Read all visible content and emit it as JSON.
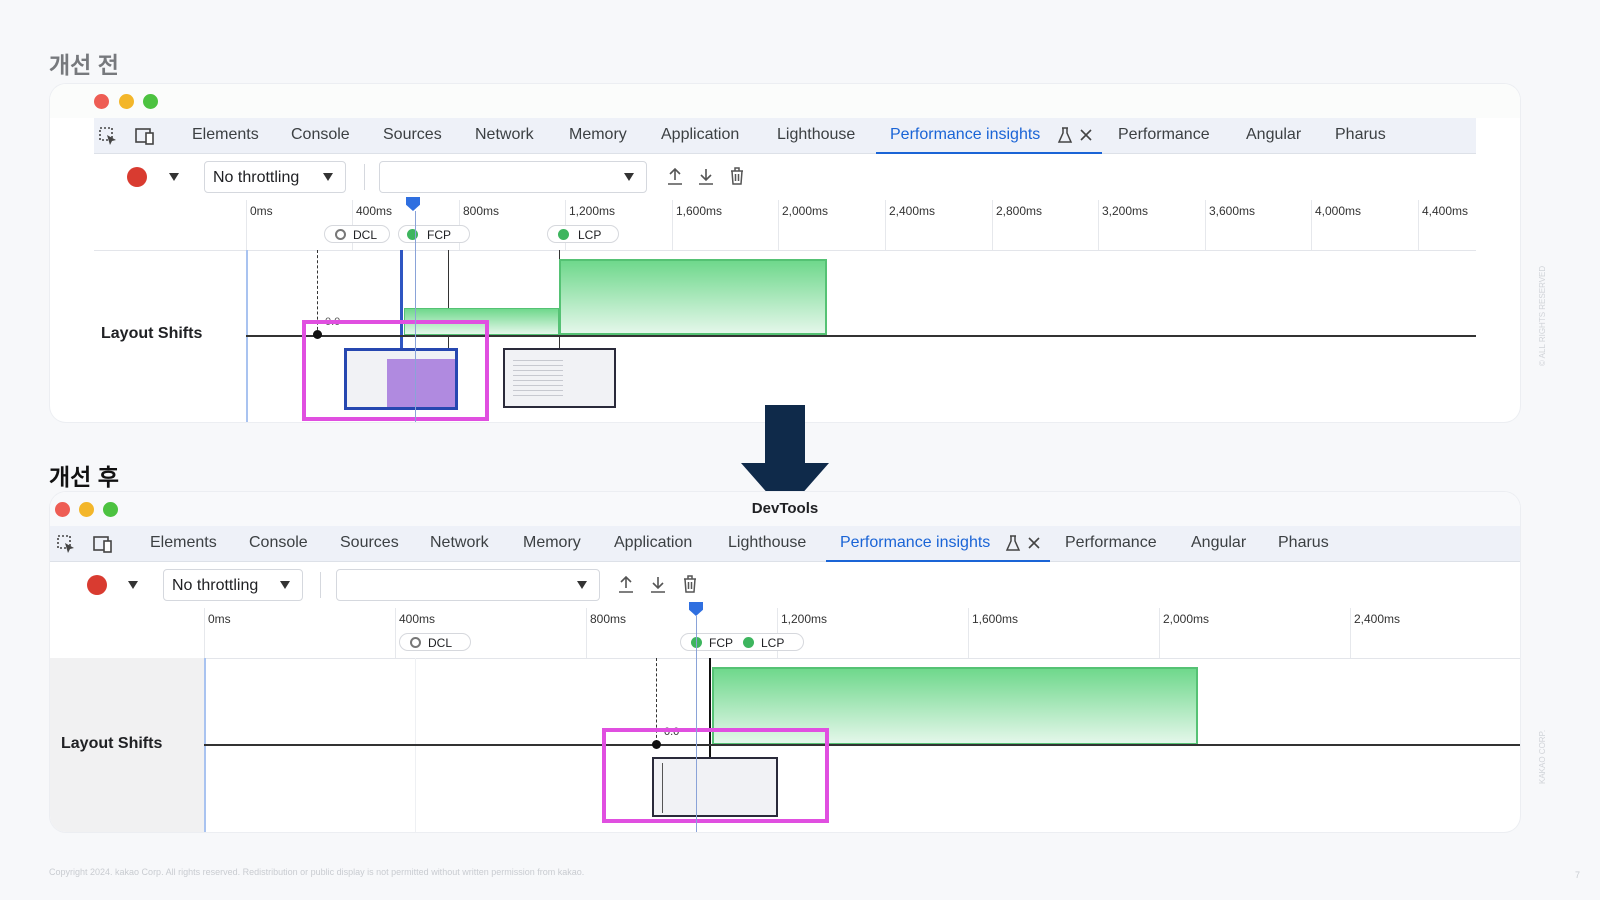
{
  "before": {
    "section_title": "개선 전",
    "tabs": [
      "Elements",
      "Console",
      "Sources",
      "Network",
      "Memory",
      "Application",
      "Lighthouse",
      "Performance insights",
      "Performance",
      "Angular",
      "Pharus"
    ],
    "throttling": "No throttling",
    "ruler_ticks": [
      "0ms",
      "400ms",
      "800ms",
      "1,200ms",
      "1,600ms",
      "2,000ms",
      "2,400ms",
      "2,800ms",
      "3,200ms",
      "3,600ms",
      "4,000ms",
      "4,400ms"
    ],
    "markers": {
      "dcl": "DCL",
      "fcp": "FCP",
      "lcp": "LCP"
    },
    "track_label": "Layout Shifts",
    "shift_value": "0.0"
  },
  "after": {
    "section_title": "개선 후",
    "window_title": "DevTools",
    "tabs": [
      "Elements",
      "Console",
      "Sources",
      "Network",
      "Memory",
      "Application",
      "Lighthouse",
      "Performance insights",
      "Performance",
      "Angular",
      "Pharus"
    ],
    "throttling": "No throttling",
    "ruler_ticks": [
      "0ms",
      "400ms",
      "800ms",
      "1,200ms",
      "1,600ms",
      "2,000ms",
      "2,400ms"
    ],
    "markers": {
      "dcl": "DCL",
      "fcp": "FCP",
      "lcp": "LCP"
    },
    "track_label": "Layout Shifts",
    "shift_value": "0.0"
  },
  "colors": {
    "accent": "#1a64d6",
    "highlight": "#e04fe0",
    "lcp_green": "#55c274",
    "arrow": "#0f2a4a",
    "record": "#d93b30"
  },
  "icons": [
    "inspect-icon",
    "device-toggle-icon",
    "record-icon",
    "upload-icon",
    "download-icon",
    "trash-icon",
    "flask-icon",
    "close-icon",
    "down-arrow-icon"
  ],
  "footer": "Copyright 2024. kakao Corp. All rights reserved. Redistribution or public display is not permitted without written permission from kakao.",
  "side_watermark_top": "© ALL RIGHTS RESERVED",
  "side_watermark_bottom": "KAKAO CORP.",
  "page_number": "7"
}
